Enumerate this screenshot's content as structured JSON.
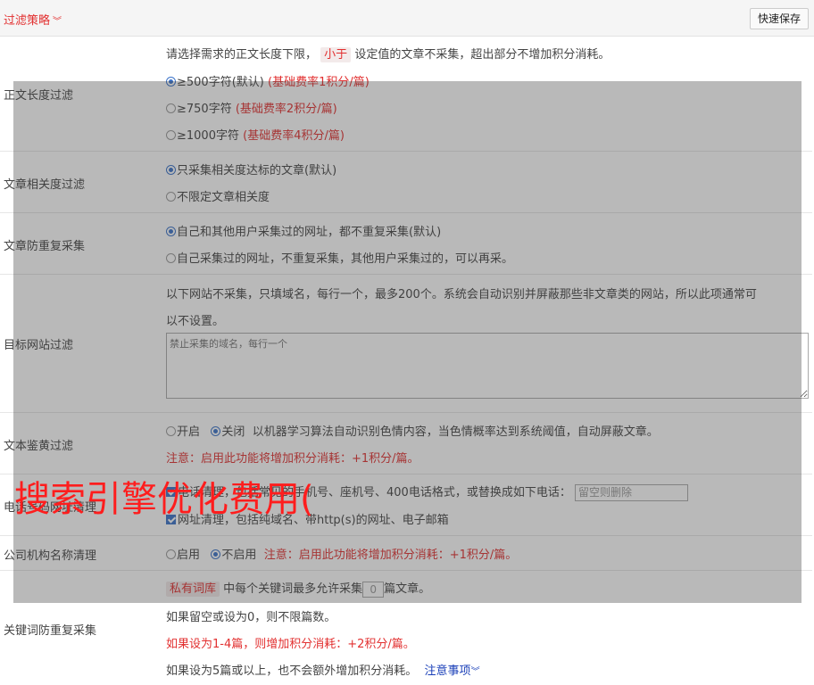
{
  "header": {
    "title": "过滤策略",
    "save_label": "快速保存"
  },
  "length_filter": {
    "label": "正文长度过滤",
    "desc_pre": "请选择需求的正文长度下限，",
    "desc_tag": "小于",
    "desc_post": "设定值的文章不采集，超出部分不增加积分消耗。",
    "options": [
      {
        "text": "≥500字符(默认)",
        "note": "(基础费率1积分/篇)"
      },
      {
        "text": "≥750字符",
        "note": "(基础费率2积分/篇)"
      },
      {
        "text": "≥1000字符",
        "note": "(基础费率4积分/篇)"
      }
    ]
  },
  "relevance": {
    "label": "文章相关度过滤",
    "opt1": "只采集相关度达标的文章(默认)",
    "opt2": "不限定文章相关度"
  },
  "dedup": {
    "label": "文章防重复采集",
    "opt1": "自己和其他用户采集过的网址，都不重复采集(默认)",
    "opt2": "自己采集过的网址，不重复采集，其他用户采集过的，可以再采。"
  },
  "site_filter": {
    "label": "目标网站过滤",
    "desc1": "以下网站不采集，只填域名，每行一个，最多200个。系统会自动识别并屏蔽那些非文章类的网站，所以此项通常可",
    "desc2": "以不设置。",
    "placeholder": "禁止采集的域名，每行一个"
  },
  "porn_filter": {
    "label": "文本鉴黄过滤",
    "on": "开启",
    "off": "关闭",
    "desc": "以机器学习算法自动识别色情内容，当色情概率达到系统阈值，自动屏蔽文章。",
    "note": "注意：启用此功能将增加积分消耗：+1积分/篇。"
  },
  "contact_clean": {
    "label": "电话号码网址清理",
    "phone_text": "电话清理，包括常见的手机号、座机号、400电话格式，或替换成如下电话：",
    "phone_placeholder": "留空则删除",
    "url_text": "网址清理，包括纯域名、带http(s)的网址、电子邮箱"
  },
  "org_clean": {
    "label": "公司机构名称清理",
    "on": "启用",
    "off": "不启用",
    "note": "注意：启用此功能将增加积分消耗：+1积分/篇。"
  },
  "keyword_dedup": {
    "label": "关键词防重复采集",
    "tag": "私有词库",
    "line1_pre": "中每个关键词最多允许采集",
    "value": "0",
    "line1_post": "篇文章。",
    "line2": "如果留空或设为0，则不限篇数。",
    "line3": "如果设为1-4篇，则增加积分消耗：+2积分/篇。",
    "line4": "如果设为5篇或以上，也不会额外增加积分消耗。",
    "link": "注意事项"
  },
  "watermark": "搜索引擎优化费用("
}
